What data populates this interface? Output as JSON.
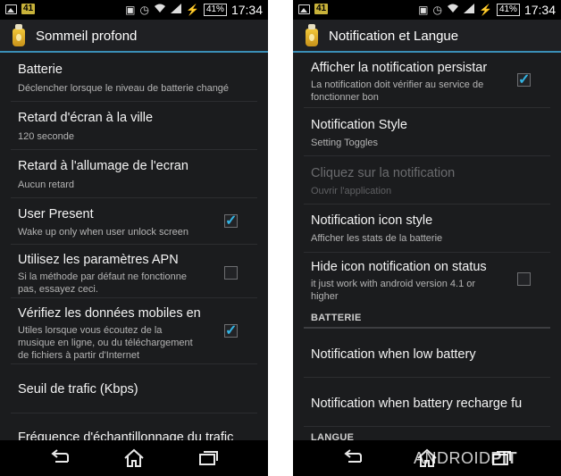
{
  "left": {
    "status": {
      "badge": "41",
      "battery": "41%",
      "time": "17:34"
    },
    "title": "Sommeil profond",
    "items": [
      {
        "title": "Batterie",
        "subtitle": "Déclencher lorsque le niveau de batterie changé"
      },
      {
        "title": "Retard d'écran à la ville",
        "subtitle": "120 seconde"
      },
      {
        "title": "Retard à l'allumage de l'ecran",
        "subtitle": "Aucun retard"
      },
      {
        "title": "User Present",
        "subtitle": "Wake up only when user unlock screen",
        "checked": true
      },
      {
        "title": "Utilisez les paramètres APN",
        "subtitle_lines": [
          "Si la méthode par défaut ne fonctionne",
          "pas, essayez ceci."
        ],
        "checked": false
      },
      {
        "title": "Vérifiez les données mobiles en",
        "subtitle_lines": [
          "Utiles lorsque vous écoutez de la",
          "musique en ligne, ou du téléchargement",
          "de fichiers à partir d'Internet"
        ],
        "checked": true
      },
      {
        "title": "Seuil de trafic (Kbps)"
      },
      {
        "title": "Fréquence d'échantillonnage du trafic"
      }
    ]
  },
  "right": {
    "status": {
      "badge": "41",
      "battery": "41%",
      "time": "17:34"
    },
    "title": "Notification et Langue",
    "items": [
      {
        "title": "Afficher la notification persistar",
        "subtitle_lines": [
          "La notification doit vérifier au service de",
          "fonctionner bon"
        ],
        "checked": true
      },
      {
        "title": "Notification Style",
        "subtitle": "Setting Toggles"
      },
      {
        "title": "Cliquez sur la notification",
        "subtitle": "Ouvrir l'application",
        "disabled": true
      },
      {
        "title": "Notification icon style",
        "subtitle": "Afficher les stats de la batterie"
      },
      {
        "title": "Hide icon notification on status",
        "subtitle_lines": [
          "it just work with android version 4.1 or",
          "higher"
        ],
        "checked": false
      },
      {
        "title": "Notification when low battery"
      },
      {
        "title": "Notification when battery recharge fu"
      }
    ],
    "sections": {
      "battery": "BATTERIE",
      "language": "LANGUE"
    }
  },
  "watermark": {
    "part1": "ANDROID",
    "part2": "PIT"
  },
  "colors": {
    "accent": "#33b5e5",
    "divider": "#3a8fb7",
    "background": "#1b1c1e"
  },
  "icons": [
    "app-bottle-icon",
    "back-icon",
    "home-icon",
    "recent-apps-icon",
    "wifi-icon",
    "signal-icon",
    "battery-icon",
    "alarm-icon",
    "vibrate-icon",
    "checkbox-icon"
  ]
}
